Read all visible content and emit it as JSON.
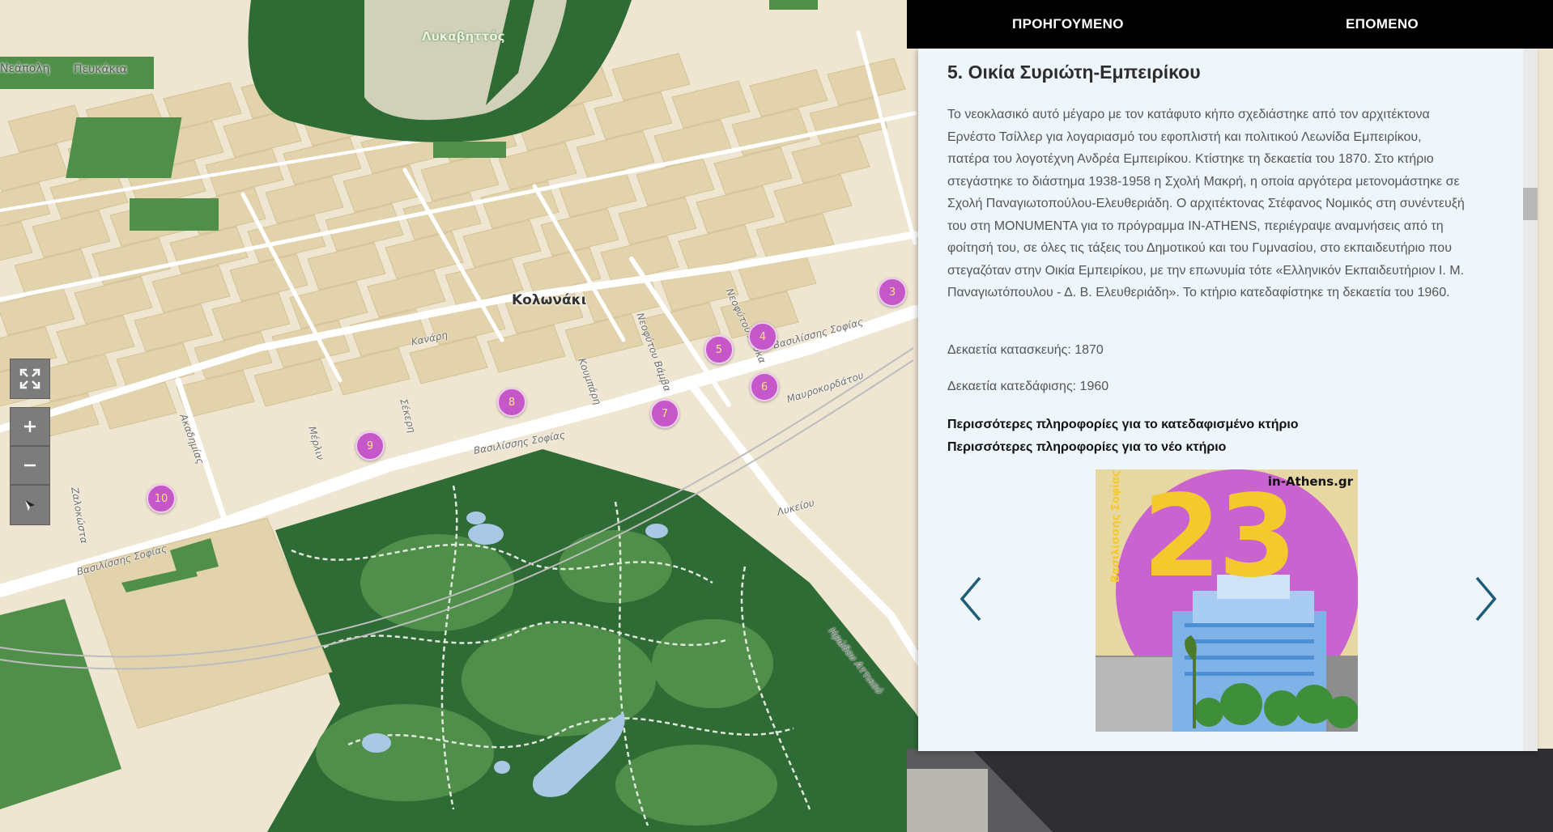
{
  "nav": {
    "prev_label": "ΠΡΟΗΓΟΥΜΕΝΟ",
    "next_label": "ΕΠΟΜΕΝΟ"
  },
  "panel": {
    "title": "5. Οικία Συριώτη-Εμπειρίκου",
    "description": "Το νεοκλασικό αυτό μέγαρο με τον κατάφυτο κήπο σχεδιάστηκε από τον αρχιτέκτονα Ερνέστο Τσίλλερ για λογαριασμό του εφοπλιστή και πολιτικού Λεωνίδα Εμπειρίκου, πατέρα του λογοτέχνη Ανδρέα Εμπειρίκου. Κτίστηκε τη δεκαετία του 1870. Στο κτήριο στεγάστηκε το διάστημα 1938-1958 η Σχολή Μακρή, η οποία αργότερα μετονομάστηκε σε Σχολή Παναγιωτοπούλου-Ελευθεριάδη. Ο αρχιτέκτονας Στέφανος Νομικός στη συνέντευξή του στη MONUMENTA για το πρόγραμμα IN-ATHENS, περιέγραψε αναμνήσεις από τη φοίτησή του, σε όλες τις τάξεις του Δημοτικού και του Γυμνασίου, στο εκπαιδευτήριο που στεγαζόταν στην Οικία Εμπειρίκου, με την επωνυμία τότε «Ελληνικόν Εκπαιδευτήριον Ι. Μ. Παναγιωτόπουλου - Δ. Β. Ελευθεριάδη». Το κτήριο κατεδαφίστηκε τη δεκαετία του 1960.",
    "construction": "Δεκαετία κατασκευής: 1870",
    "demolition": "Δεκαετία κατεδάφισης: 1960",
    "link_demolished": "Περισσότερες πληροφορίες για το κατεδαφισμένο κτήριο",
    "link_new": "Περισσότερες πληροφορίες για το νέο κτήριο",
    "image": {
      "brand": "in-Athens.gr",
      "number": "23",
      "street": "Βασιλίσσης Σοφίας"
    }
  },
  "map": {
    "places": {
      "lykavittos": "Λυκαβηττός",
      "kolonaki": "Κολωνάκι",
      "neapoli": "Νεάπολη",
      "pefkakia": "Πευκάκια"
    },
    "streets": {
      "vas_sofias_1": "Βασιλίσσης Σοφίας",
      "vas_sofias_2": "Βασιλίσσης Σοφίας",
      "vas_sofias_3": "Βασιλίσσης Σοφίας",
      "irodou_attikou": "Ηρώδου Αττικού",
      "lykeiou": "Λυκείου",
      "kanari": "Κανάρη",
      "akadimias": "Ακαδημίας",
      "merlin": "Μέρλιν",
      "sekeri": "Σέκερη",
      "zalokosta": "Ζαλοκώστα",
      "koumpari": "Κουμπάρη",
      "neofytou_vamva": "Νεοφύτου Βάμβα",
      "neofytou_douka": "Νεοφύτου Δούκα",
      "mavrokordatou": "Μαυροκορδάτου"
    },
    "markers": [
      "3",
      "4",
      "5",
      "6",
      "7",
      "8",
      "9",
      "10"
    ],
    "colors": {
      "land": "#efe6d2",
      "block": "#e2d3ad",
      "road": "#ffffff",
      "park_dark": "#2f6b35",
      "park_light": "#4f8f4a",
      "water": "#a8c8e4",
      "marker": "#c557c9"
    },
    "controls": {
      "fullscreen": "fullscreen-icon",
      "zoom_in": "plus-icon",
      "zoom_out": "minus-icon",
      "compass": "compass-icon"
    }
  }
}
